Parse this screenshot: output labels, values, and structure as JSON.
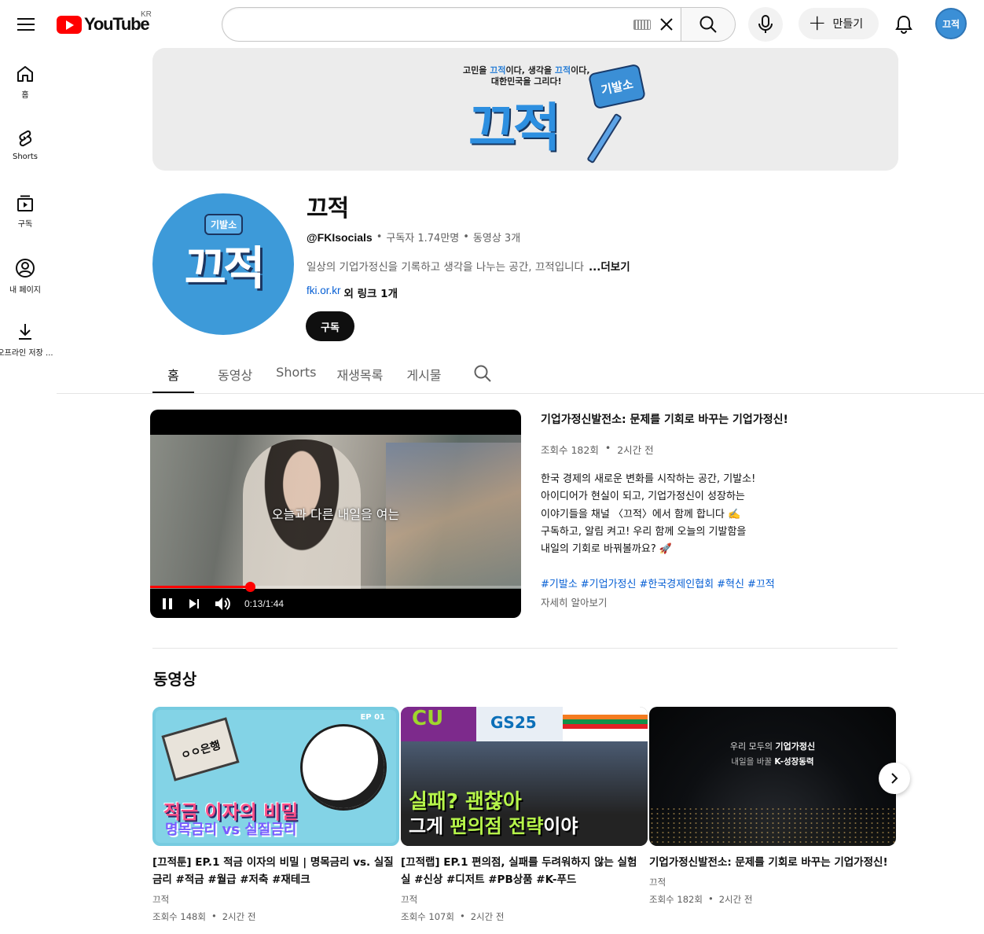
{
  "topbar": {
    "logo_text": "YouTube",
    "region": "KR",
    "search_placeholder": "",
    "create_label": "만들기",
    "avatar_text": "끄적"
  },
  "sidebar": {
    "items": [
      {
        "label": "홈",
        "icon": "home-icon"
      },
      {
        "label": "Shorts",
        "icon": "shorts-icon"
      },
      {
        "label": "구독",
        "icon": "subscriptions-icon"
      },
      {
        "label": "내 페이지",
        "icon": "profile-icon"
      },
      {
        "label": "오프라인 저장 ...",
        "icon": "download-icon"
      }
    ]
  },
  "banner": {
    "line1_a": "고민을 ",
    "line1_hl1": "끄적",
    "line1_b": "이다, 생각을 ",
    "line1_hl2": "끄적",
    "line1_c": "이다,",
    "line2": "대한민국을 그리다!",
    "big": "끄적",
    "badge": "기발소"
  },
  "channel": {
    "name": "끄적",
    "avatar_text": "끄적",
    "avatar_tag": "기발소",
    "handle": "@FKIsocials",
    "subscribers": "구독자 1.74만명",
    "videos": "동영상 3개",
    "description": "일상의 기업가정신을 기록하고 생각을 나누는 공간, 끄적입니다",
    "more": "...더보기",
    "link": "fki.or.kr",
    "link_rest": "외 링크 1개",
    "subscribe_label": "구독"
  },
  "tabs": [
    "홈",
    "동영상",
    "Shorts",
    "재생목록",
    "게시물"
  ],
  "featured": {
    "caption": "오늘과 다른 내일을 여는",
    "progress": 0.27,
    "time": "0:13/1:44",
    "title": "기업가정신발전소: 문제를 기회로 바꾸는 기업가정신!",
    "views": "조회수 182회",
    "ago": "2시간 전",
    "description": "한국 경제의 새로운 변화를 시작하는 공간, 기발소!\n아이디어가 현실이 되고, 기업가정신이 성장하는\n이야기들을 채널 〈끄적〉에서 함께 합니다 ✍️\n구독하고, 알림 켜고! 우리 함께 오늘의 기발함을\n내일의 기회로 바꿔볼까요? 🚀",
    "tags": [
      "#기발소",
      "#기업가정신",
      "#한국경제인협회",
      "#혁신",
      "#끄적"
    ],
    "learn_more": "자세히 알아보기"
  },
  "videos_section": {
    "title": "동영상",
    "items": [
      {
        "title": "[끄적툰] EP.1 적금 이자의 비밀 | 명목금리 vs. 실질금리 #적금 #월급 #저축 #재테크",
        "channel": "끄적",
        "views": "조회수 148회",
        "ago": "2시간 전",
        "thumb_ep": "EP 01",
        "thumb_big": "적금 이자의 비밀",
        "thumb_small": "명목금리 vs 실질금리",
        "thumb_bank": "ㅇㅇ은행"
      },
      {
        "title": "[끄적랩] EP.1 편의점, 실패를 두려워하지 않는 실험실 #신상 #디저트 #PB상품 #K-푸드",
        "channel": "끄적",
        "views": "조회수 107회",
        "ago": "2시간 전",
        "thumb_cu": "CU",
        "thumb_gs": "GS25",
        "thumb_big": "실패? 괜찮아",
        "thumb_big2_a": "그게 ",
        "thumb_big2_b": "편의점 전략",
        "thumb_big2_c": "이야"
      },
      {
        "title": "기업가정신발전소: 문제를 기회로 바꾸는 기업가정신!",
        "channel": "끄적",
        "views": "조회수 182회",
        "ago": "2시간 전",
        "thumb_l1_a": "우리 모두의 ",
        "thumb_l1_b": "기업가정신",
        "thumb_l2_a": "내일을 바꿀 ",
        "thumb_l2_b": "K-성장동력"
      }
    ]
  }
}
